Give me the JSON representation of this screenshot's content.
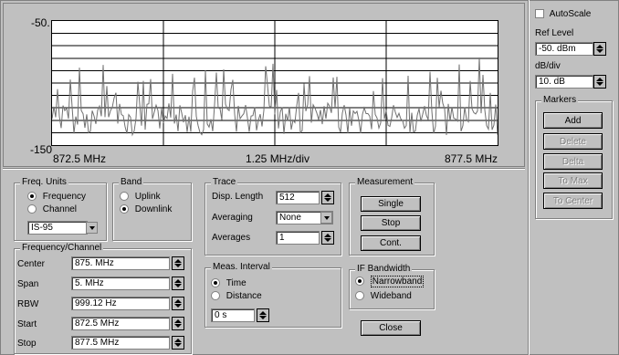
{
  "plot": {
    "ref_label": "-50.",
    "bottom_label": "-150",
    "x_start": "872.5 MHz",
    "x_div": "1.25 MHz/div",
    "x_end": "877.5 MHz"
  },
  "right_panel": {
    "autoscale_label": "AutoScale",
    "autoscale_checked": false,
    "ref_level_label": "Ref Level",
    "ref_level_value": "-50. dBm",
    "dbdiv_label": "dB/div",
    "dbdiv_value": "10. dB",
    "markers_title": "Markers",
    "buttons": [
      {
        "label": "Add",
        "enabled": true
      },
      {
        "label": "Delete",
        "enabled": false
      },
      {
        "label": "Delta",
        "enabled": false
      },
      {
        "label": "To Max",
        "enabled": false
      },
      {
        "label": "To Center",
        "enabled": false
      }
    ]
  },
  "freq_units": {
    "title": "Freq. Units",
    "options": [
      "Frequency",
      "Channel"
    ],
    "selected": 0,
    "standard": "IS-95"
  },
  "band": {
    "title": "Band",
    "options": [
      "Uplink",
      "Downlink"
    ],
    "selected": 1
  },
  "freq_channel": {
    "title": "Frequency/Channel",
    "fields": [
      {
        "label": "Center",
        "value": "875. MHz"
      },
      {
        "label": "Span",
        "value": "5. MHz"
      },
      {
        "label": "RBW",
        "value": "999.12 Hz"
      },
      {
        "label": "Start",
        "value": "872.5 MHz"
      },
      {
        "label": "Stop",
        "value": "877.5 MHz"
      }
    ]
  },
  "trace": {
    "title": "Trace",
    "disp_length_label": "Disp. Length",
    "disp_length_value": "512",
    "averaging_label": "Averaging",
    "averaging_value": "None",
    "averages_label": "Averages",
    "averages_value": "1"
  },
  "meas_interval": {
    "title": "Meas. Interval",
    "options": [
      "Time",
      "Distance"
    ],
    "selected": 0,
    "value": "0 s"
  },
  "measurement": {
    "title": "Measurement",
    "buttons": [
      "Single",
      "Stop",
      "Cont."
    ]
  },
  "if_bandwidth": {
    "title": "IF Bandwidth",
    "options": [
      "Narrowband",
      "Wideband"
    ],
    "selected": 0
  },
  "close_label": "Close"
}
